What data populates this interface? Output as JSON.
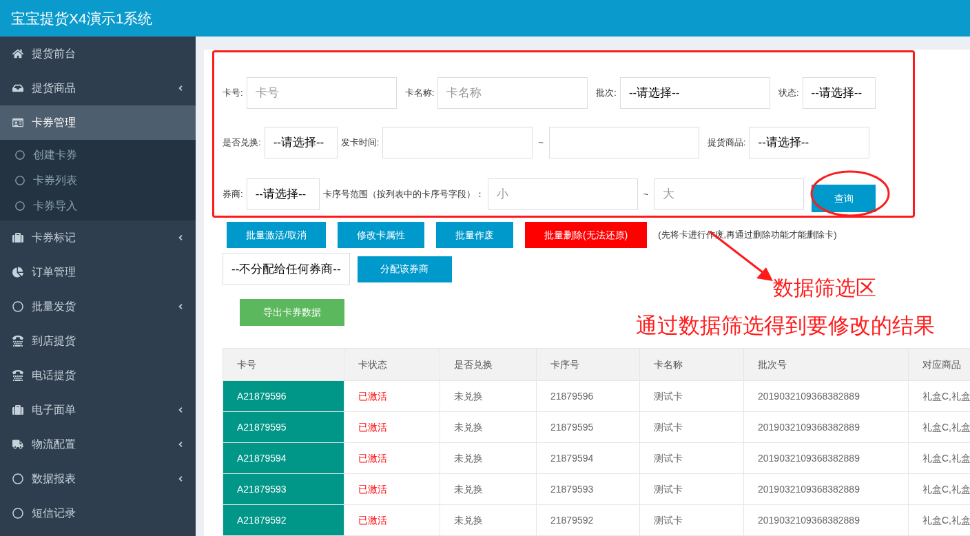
{
  "header": {
    "title": "宝宝提货X4演示1系统"
  },
  "sidebar": {
    "items": [
      {
        "label": "提货前台",
        "has_submenu": false,
        "selected": false
      },
      {
        "label": "提货商品",
        "has_submenu": true,
        "selected": false
      },
      {
        "label": "卡券管理",
        "has_submenu": false,
        "selected": true,
        "expanded": true,
        "children": [
          {
            "label": "创建卡券"
          },
          {
            "label": "卡券列表"
          },
          {
            "label": "卡券导入"
          }
        ]
      },
      {
        "label": "卡券标记",
        "has_submenu": true,
        "selected": false
      },
      {
        "label": "订单管理",
        "has_submenu": false,
        "selected": false
      },
      {
        "label": "批量发货",
        "has_submenu": true,
        "selected": false
      },
      {
        "label": "到店提货",
        "has_submenu": false,
        "selected": false
      },
      {
        "label": "电话提货",
        "has_submenu": false,
        "selected": false
      },
      {
        "label": "电子面单",
        "has_submenu": true,
        "selected": false
      },
      {
        "label": "物流配置",
        "has_submenu": true,
        "selected": false
      },
      {
        "label": "数据报表",
        "has_submenu": true,
        "selected": false
      },
      {
        "label": "短信记录",
        "has_submenu": false,
        "selected": false
      }
    ]
  },
  "filters": {
    "card_no": {
      "label": "卡号:",
      "placeholder": "卡号"
    },
    "card_name": {
      "label": "卡名称:",
      "placeholder": "卡名称"
    },
    "batch": {
      "label": "批次:",
      "value": "--请选择--"
    },
    "status": {
      "label": "状态:",
      "value": "--请选择--"
    },
    "redeemed": {
      "label": "是否兑换:",
      "value": "--请选择--"
    },
    "issue_time": {
      "label": "发卡时间:",
      "separator": "~"
    },
    "product": {
      "label": "提货商品:",
      "value": "--请选择--"
    },
    "dealer": {
      "label": "券商:",
      "value": "--请选择--"
    },
    "serial_range": {
      "label": "卡序号范围（按列表中的卡序号字段）：",
      "min_placeholder": "小",
      "separator": "~",
      "max_placeholder": "大"
    },
    "query_button": "查询"
  },
  "actions": [
    {
      "label": "批量激活/取消",
      "kind": "primary"
    },
    {
      "label": "修改卡属性",
      "kind": "primary"
    },
    {
      "label": "批量作废",
      "kind": "primary"
    },
    {
      "label": "批量删除(无法还原)",
      "kind": "danger"
    }
  ],
  "action_note": "(先将卡进行作废,再通过删除功能才能删除卡)",
  "assign": {
    "value": "--不分配给任何券商--",
    "button": "分配该券商"
  },
  "export_button": "导出卡券数据",
  "annotations": [
    "数据筛选区",
    "通过数据筛选得到要修改的结果"
  ],
  "table": {
    "columns": [
      "卡号",
      "卡状态",
      "是否兑换",
      "卡序号",
      "卡名称",
      "批次号",
      "对应商品"
    ],
    "rows": [
      [
        "A21879596",
        "已激活",
        "未兑换",
        "21879596",
        "测试卡",
        "2019032109368382889",
        "礼盒C,礼盒"
      ],
      [
        "A21879595",
        "已激活",
        "未兑换",
        "21879595",
        "测试卡",
        "2019032109368382889",
        "礼盒C,礼盒"
      ],
      [
        "A21879594",
        "已激活",
        "未兑换",
        "21879594",
        "测试卡",
        "2019032109368382889",
        "礼盒C,礼盒"
      ],
      [
        "A21879593",
        "已激活",
        "未兑换",
        "21879593",
        "测试卡",
        "2019032109368382889",
        "礼盒C,礼盒"
      ],
      [
        "A21879592",
        "已激活",
        "未兑换",
        "21879592",
        "测试卡",
        "2019032109368382889",
        "礼盒C,礼盒"
      ]
    ]
  }
}
